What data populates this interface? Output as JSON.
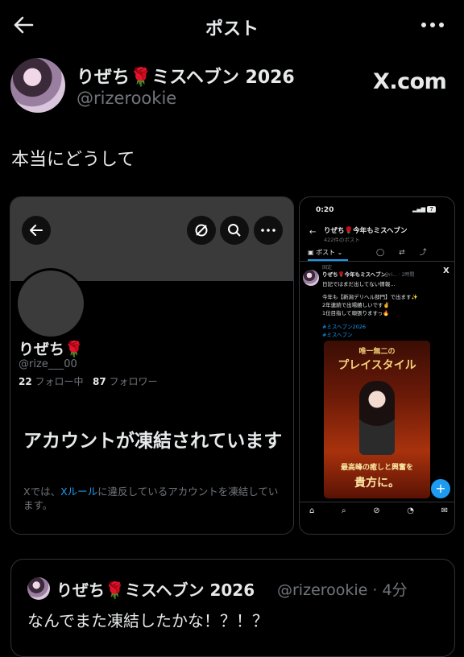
{
  "topbar": {
    "title": "ポスト"
  },
  "post": {
    "display_name": "りぜち🌹ミスヘブン 2026",
    "handle": "@rizerookie",
    "brand": "X.com",
    "text": "本当にどうして"
  },
  "left_shot": {
    "name": "りぜち🌹",
    "handle": "@rize___00",
    "following_count": "22",
    "following_label": "フォロー中",
    "followers_count": "87",
    "followers_label": "フォロワー",
    "suspended_title": "アカウントが凍結されています",
    "notice_prefix": "Xでは、",
    "notice_link": "Xルール",
    "notice_suffix": "に違反しているアカウントを凍結しています。"
  },
  "right_shot": {
    "time": "0:20",
    "battery": "7",
    "header_name": "りぜち🌹今年もミスヘブン",
    "post_count": "422件のポスト",
    "tab_label": "ポスト",
    "pinned_label": "固定",
    "tweet_name": "りぜち🌹今年もミスヘブン",
    "tweet_meta": "@ri... · 2時間",
    "tweet_line1": "日記ではまだ出してない情報…",
    "tweet_line2": "今年も【新潟デリヘル部門】で出ます✨",
    "tweet_line3": "2年連続で出場嬉しいです✌️",
    "tweet_line4": "1位目指して頑張りますっ🔥",
    "tag1": "#ミスヘブン2026",
    "tag2": "#ミスヘブン",
    "poster_top": "唯一無二の",
    "poster_title": "プレイスタイル",
    "poster_bottom1": "最高峰の癒しと興奮を",
    "poster_bottom2": "貴方に。",
    "fab": "+"
  },
  "quote": {
    "name": "りぜち🌹ミスヘブン 2026",
    "handle_time": "@rizerookie · 4分",
    "text": "なんでまた凍結したかな！？！？"
  },
  "colors": {
    "accent": "#1d9bf0",
    "bg": "#000000",
    "rose": "#d0021b"
  }
}
